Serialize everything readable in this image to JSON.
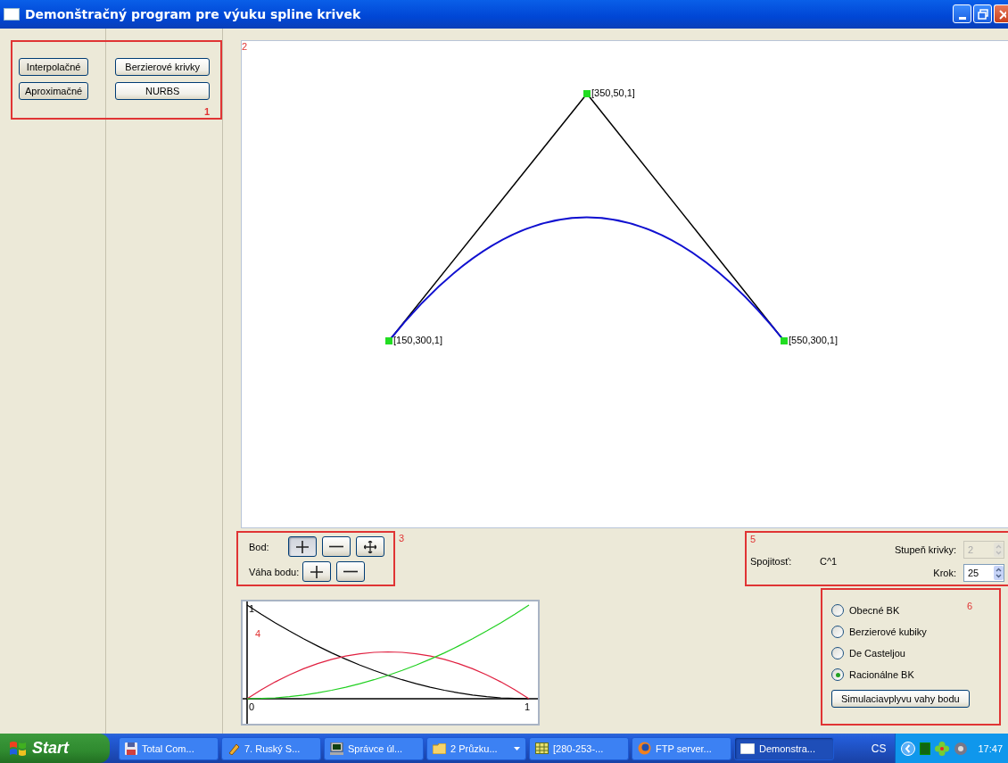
{
  "window": {
    "title": "Demonštračný program pre výuku spline krivek"
  },
  "curve_menu": {
    "box_number": "1",
    "columns": [
      [
        "Interpolačné",
        "Aproximačné"
      ],
      [
        "Berzierové krivky",
        "NURBS"
      ]
    ]
  },
  "canvas": {
    "box_number": "2",
    "control_points": [
      {
        "label": "[150,300,1]"
      },
      {
        "label": "[350,50,1]"
      },
      {
        "label": "[550,300,1]"
      }
    ]
  },
  "point_tools": {
    "box_number": "3",
    "rows": [
      {
        "label": "Bod:",
        "buttons": [
          {
            "kind": "plus",
            "selected": true
          },
          {
            "kind": "minus",
            "selected": false
          },
          {
            "kind": "move",
            "selected": false
          }
        ]
      },
      {
        "label": "Váha bodu:",
        "buttons": [
          {
            "kind": "plus",
            "selected": false
          },
          {
            "kind": "minus",
            "selected": false
          }
        ]
      }
    ]
  },
  "basis_chart": {
    "box_number": "4",
    "y_axis_label": "1",
    "origin_label": "0",
    "x_axis_label": "1"
  },
  "curve_settings": {
    "box_number": "5",
    "continuity_label": "Spojitosť:",
    "continuity_value": "C^1",
    "degree": {
      "label": "Stupeň krivky:",
      "value": "2",
      "disabled": true
    },
    "step": {
      "label": "Krok:",
      "value": "25",
      "disabled": false
    }
  },
  "curve_type": {
    "box_number": "6",
    "options": [
      {
        "label": "Obecné BK",
        "selected": false
      },
      {
        "label": "Berzierové kubiky",
        "selected": false
      },
      {
        "label": "De Casteljou",
        "selected": false
      },
      {
        "label": "Racionálne BK",
        "selected": true
      }
    ],
    "button": "Simulaciavplyvu vahy bodu"
  },
  "taskbar": {
    "start": "Start",
    "tasks": [
      {
        "label": "Total Com...",
        "group": false,
        "selected": false
      },
      {
        "label": "7. Ruský S...",
        "group": false,
        "selected": false
      },
      {
        "label": "Správce úl...",
        "group": false,
        "selected": false
      },
      {
        "label": "2 Průzku...",
        "group": true,
        "selected": false
      },
      {
        "label": "[280-253-...",
        "group": false,
        "selected": false
      },
      {
        "label": "FTP server...",
        "group": false,
        "selected": false
      },
      {
        "label": "Demonstra...",
        "group": false,
        "selected": true
      }
    ],
    "language": "CS",
    "clock": "17:47"
  }
}
